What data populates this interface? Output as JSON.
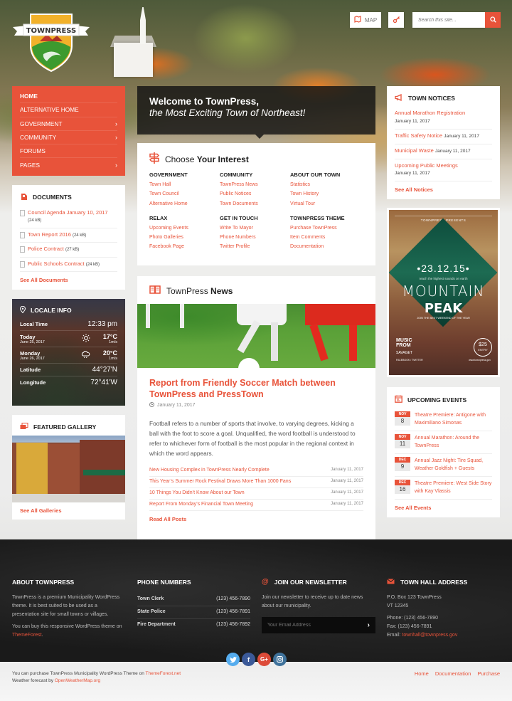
{
  "brand": {
    "name": "TOWNPRESS"
  },
  "colors": {
    "accent": "#e8533a",
    "dark": "#1a1a1a",
    "twitter": "#55acee",
    "facebook": "#3b5998",
    "googleplus": "#dd4b39",
    "instagram": "#3f729b"
  },
  "header": {
    "map_label": "MAP",
    "search_placeholder": "Search this site..."
  },
  "nav": [
    {
      "label": "HOME",
      "active": true,
      "submenu": false
    },
    {
      "label": "ALTERNATIVE HOME",
      "submenu": false
    },
    {
      "label": "GOVERNMENT",
      "submenu": true
    },
    {
      "label": "COMMUNITY",
      "submenu": true
    },
    {
      "label": "FORUMS",
      "submenu": false
    },
    {
      "label": "PAGES",
      "submenu": true
    }
  ],
  "documents": {
    "title": "DOCUMENTS",
    "items": [
      {
        "name": "Council Agenda January 10, 2017",
        "size": "(24 kB)"
      },
      {
        "name": "Town Report 2016",
        "size": "(24 kB)"
      },
      {
        "name": "Police Contract",
        "size": "(27 kB)"
      },
      {
        "name": "Public Schools Contract",
        "size": "(24 kB)"
      }
    ],
    "more": "See All Documents"
  },
  "locale": {
    "title": "LOCALE INFO",
    "local_time_label": "Local Time",
    "local_time": "12:33 pm",
    "today": {
      "label": "Today",
      "date": "June 25, 2017",
      "icon": "sun-icon",
      "temp": "17°C",
      "wind": "1m/s"
    },
    "tomorrow": {
      "label": "Monday",
      "date": "June 26, 2017",
      "icon": "rain-cloud-icon",
      "temp": "20°C",
      "wind": "1m/s"
    },
    "latitude_label": "Latitude",
    "latitude": "44°27'N",
    "longitude_label": "Longitude",
    "longitude": "72°41'W"
  },
  "gallery": {
    "title": "FEATURED GALLERY",
    "more": "See All Galleries"
  },
  "welcome": {
    "line1": "Welcome to TownPress,",
    "line2": "the Most Exciting Town of Northeast!"
  },
  "interest": {
    "title_light": "Choose",
    "title_bold": "Your Interest",
    "columns": [
      {
        "heading": "GOVERNMENT",
        "links": [
          "Town Hall",
          "Town Council",
          "Alternative Home"
        ]
      },
      {
        "heading": "COMMUNITY",
        "links": [
          "TownPress News",
          "Public Notices",
          "Town Documents"
        ]
      },
      {
        "heading": "ABOUT OUR TOWN",
        "links": [
          "Statistics",
          "Town History",
          "Virtual Tour"
        ]
      },
      {
        "heading": "RELAX",
        "links": [
          "Upcoming Events",
          "Photo Galleries",
          "Facebook Page"
        ]
      },
      {
        "heading": "GET IN TOUCH",
        "links": [
          "Write To Mayor",
          "Phone Numbers",
          "Twitter Profile"
        ]
      },
      {
        "heading": "TOWNPRESS THEME",
        "links": [
          "Purchase TownPress",
          "Item Comments",
          "Documentation"
        ]
      }
    ]
  },
  "news": {
    "title_light": "TownPress",
    "title_bold": "News",
    "featured": {
      "title": "Report from Friendly Soccer Match between TownPress and PressTown",
      "date": "January 11, 2017",
      "excerpt": "Football refers to a number of sports that involve, to varying degrees, kicking a ball with the foot to score a goal. Unqualified, the word football is understood to refer to whichever form of football is the most popular in the regional context in which the word appears."
    },
    "list": [
      {
        "title": "New Housing Complex in TownPress Nearly Complete",
        "date": "January 11, 2017"
      },
      {
        "title": "This Year’s Summer Rock Festival Draws More Than 1000 Fans",
        "date": "January 11, 2017"
      },
      {
        "title": "10 Things You Didn’t Know About our Town",
        "date": "January 11, 2017"
      },
      {
        "title": "Report From Monday’s Financial Town Meeting",
        "date": "January 11, 2017"
      }
    ],
    "more": "Read All Posts"
  },
  "notices": {
    "title": "TOWN NOTICES",
    "items": [
      {
        "title": "Annual Marathon Registration",
        "date": "January 11, 2017"
      },
      {
        "title": "Traffic Safety Notice",
        "date": "January 11, 2017"
      },
      {
        "title": "Municipal Waste",
        "date": "January 11, 2017"
      },
      {
        "title": "Upcoming Public Meetings",
        "date": "January 11, 2017"
      }
    ],
    "more": "See All Notices"
  },
  "poster": {
    "presents": "TOWNPRESS PRESENTS",
    "date": "•23.12.15•",
    "tagline": "reach the highest sounds on earth",
    "title1": "MOUNTAIN",
    "title2": "PEAK",
    "subtitle": "JOIN THE BEST WEEKEND OF THE YEAR",
    "music": "MUSIC FROM",
    "artist": "SAVAGET",
    "social": "FACEBOOK / TWITTER",
    "price": "$25",
    "entry": "ENTRY",
    "site": "www.townpress.gov"
  },
  "events": {
    "title": "UPCOMING EVENTS",
    "items": [
      {
        "month": "NOV",
        "day": "8",
        "title": "Theatre Premiere: Antigone with Maximiliano Simonas"
      },
      {
        "month": "NOV",
        "day": "11",
        "title": "Annual Marathon: Around the TownPress"
      },
      {
        "month": "DEC",
        "day": "9",
        "title": "Annual Jazz Night: Tire Squad, Weather Goldfish + Guests"
      },
      {
        "month": "DEC",
        "day": "16",
        "title": "Theatre Premiere: West Side Story with Kay Vlassis"
      }
    ],
    "more": "See All Events"
  },
  "footer": {
    "about": {
      "title": "ABOUT TOWNPRESS",
      "text1": "TownPress is a premium Municipality WordPress theme. It is best suited to be used as a presentation site for small towns or villages.",
      "text2_pre": "You can buy this responsive WordPress theme on ",
      "text2_link": "ThemeForest",
      "text2_post": "."
    },
    "phones": {
      "title": "PHONE NUMBERS",
      "items": [
        {
          "name": "Town Clerk",
          "number": "(123) 456-7890"
        },
        {
          "name": "State Police",
          "number": "(123) 456-7891"
        },
        {
          "name": "Fire Department",
          "number": "(123) 456-7892"
        }
      ]
    },
    "newsletter": {
      "title": "JOIN OUR NEWSLETTER",
      "text": "Join our newsletter to receive up to date news about our municipality.",
      "placeholder": "Your Email Address"
    },
    "address": {
      "title": "TOWN HALL ADDRESS",
      "line1": "P.O. Box 123 TownPress",
      "line2": "VT 12345",
      "phone": "Phone: (123) 456-7890",
      "fax": "Fax: (123) 456-7891",
      "email_label": "Email: ",
      "email": "townhall@townpress.gov"
    }
  },
  "bottom": {
    "line1_pre": "You can purchase TownPress Municipality WordPress Theme on ",
    "line1_link": "ThemeForest.net",
    "line2_pre": "Weather forecast by ",
    "line2_link": "OpenWeatherMap.org",
    "nav": [
      "Home",
      "Documentation",
      "Purchase"
    ]
  }
}
